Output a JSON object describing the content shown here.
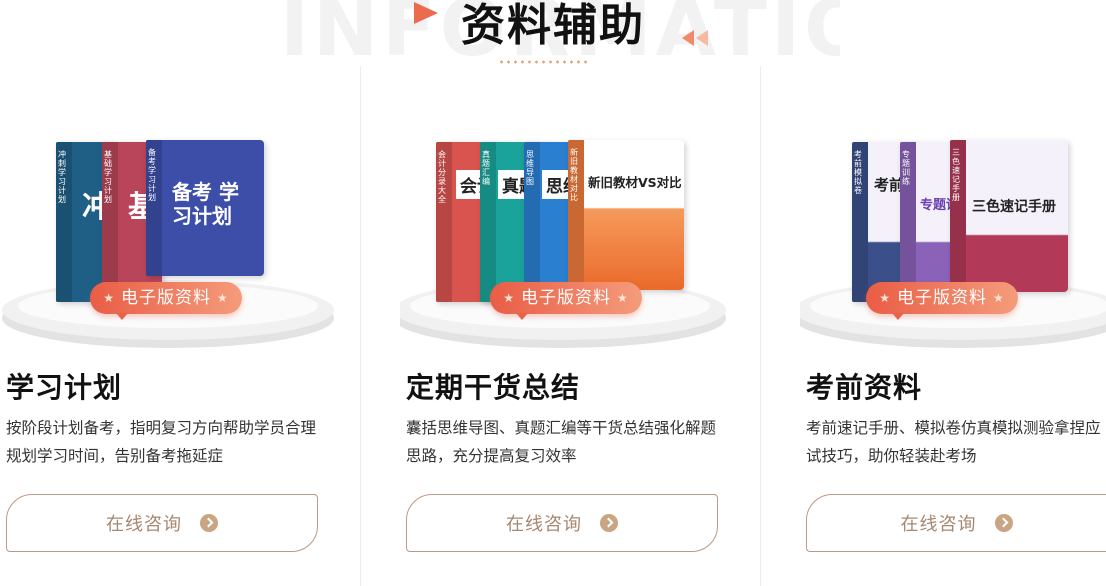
{
  "header": {
    "bg_word": "INFORMATION",
    "title": "资料辅助"
  },
  "colors": {
    "accent": "#e95d45",
    "button_border": "#b89a86",
    "button_text": "#a6876f"
  },
  "cards": [
    {
      "title": "学习计划",
      "desc": "按阶段计划备考，指明复习方向帮助学员合理规划学习时间，告别备考拖延症",
      "badge": "电子版资料",
      "button": "在线咨询",
      "books": [
        {
          "spine": "冲刺学习计划",
          "cover": "冲",
          "color": "#1f5f86"
        },
        {
          "spine": "基础学习计划",
          "cover": "基",
          "color": "#b8455a"
        },
        {
          "spine": "备考学习计划",
          "cover": "备考 学习计划",
          "color": "#3c4ea8"
        }
      ]
    },
    {
      "title": "定期干货总结",
      "desc": "囊括思维导图、真题汇编等干货总结强化解题思路，充分提高复习效率",
      "badge": "电子版资料",
      "button": "在线咨询",
      "books": [
        {
          "spine": "会计分录大全",
          "cover": "会计",
          "color": "#d9534f"
        },
        {
          "spine": "真题汇编",
          "cover": "真题",
          "color": "#1aa39a"
        },
        {
          "spine": "思维导图",
          "cover": "思维",
          "color": "#2a7fd0"
        },
        {
          "spine": "新旧教材对比",
          "cover": "新旧教材VS对比",
          "color": "#ee7a3c"
        }
      ]
    },
    {
      "title": "考前资料",
      "desc": "考前速记手册、模拟卷仿真模拟测验拿捏应试技巧，助你轻装赴考场",
      "badge": "电子版资料",
      "button": "在线咨询",
      "books": [
        {
          "spine": "考前模拟卷",
          "cover": "考前",
          "color": "#3b4f8a"
        },
        {
          "spine": "专题训练",
          "cover": "专题训",
          "color": "#8a62b8"
        },
        {
          "spine": "三色速记手册",
          "cover": "三色速记手册",
          "color": "#b23a58"
        }
      ]
    }
  ]
}
